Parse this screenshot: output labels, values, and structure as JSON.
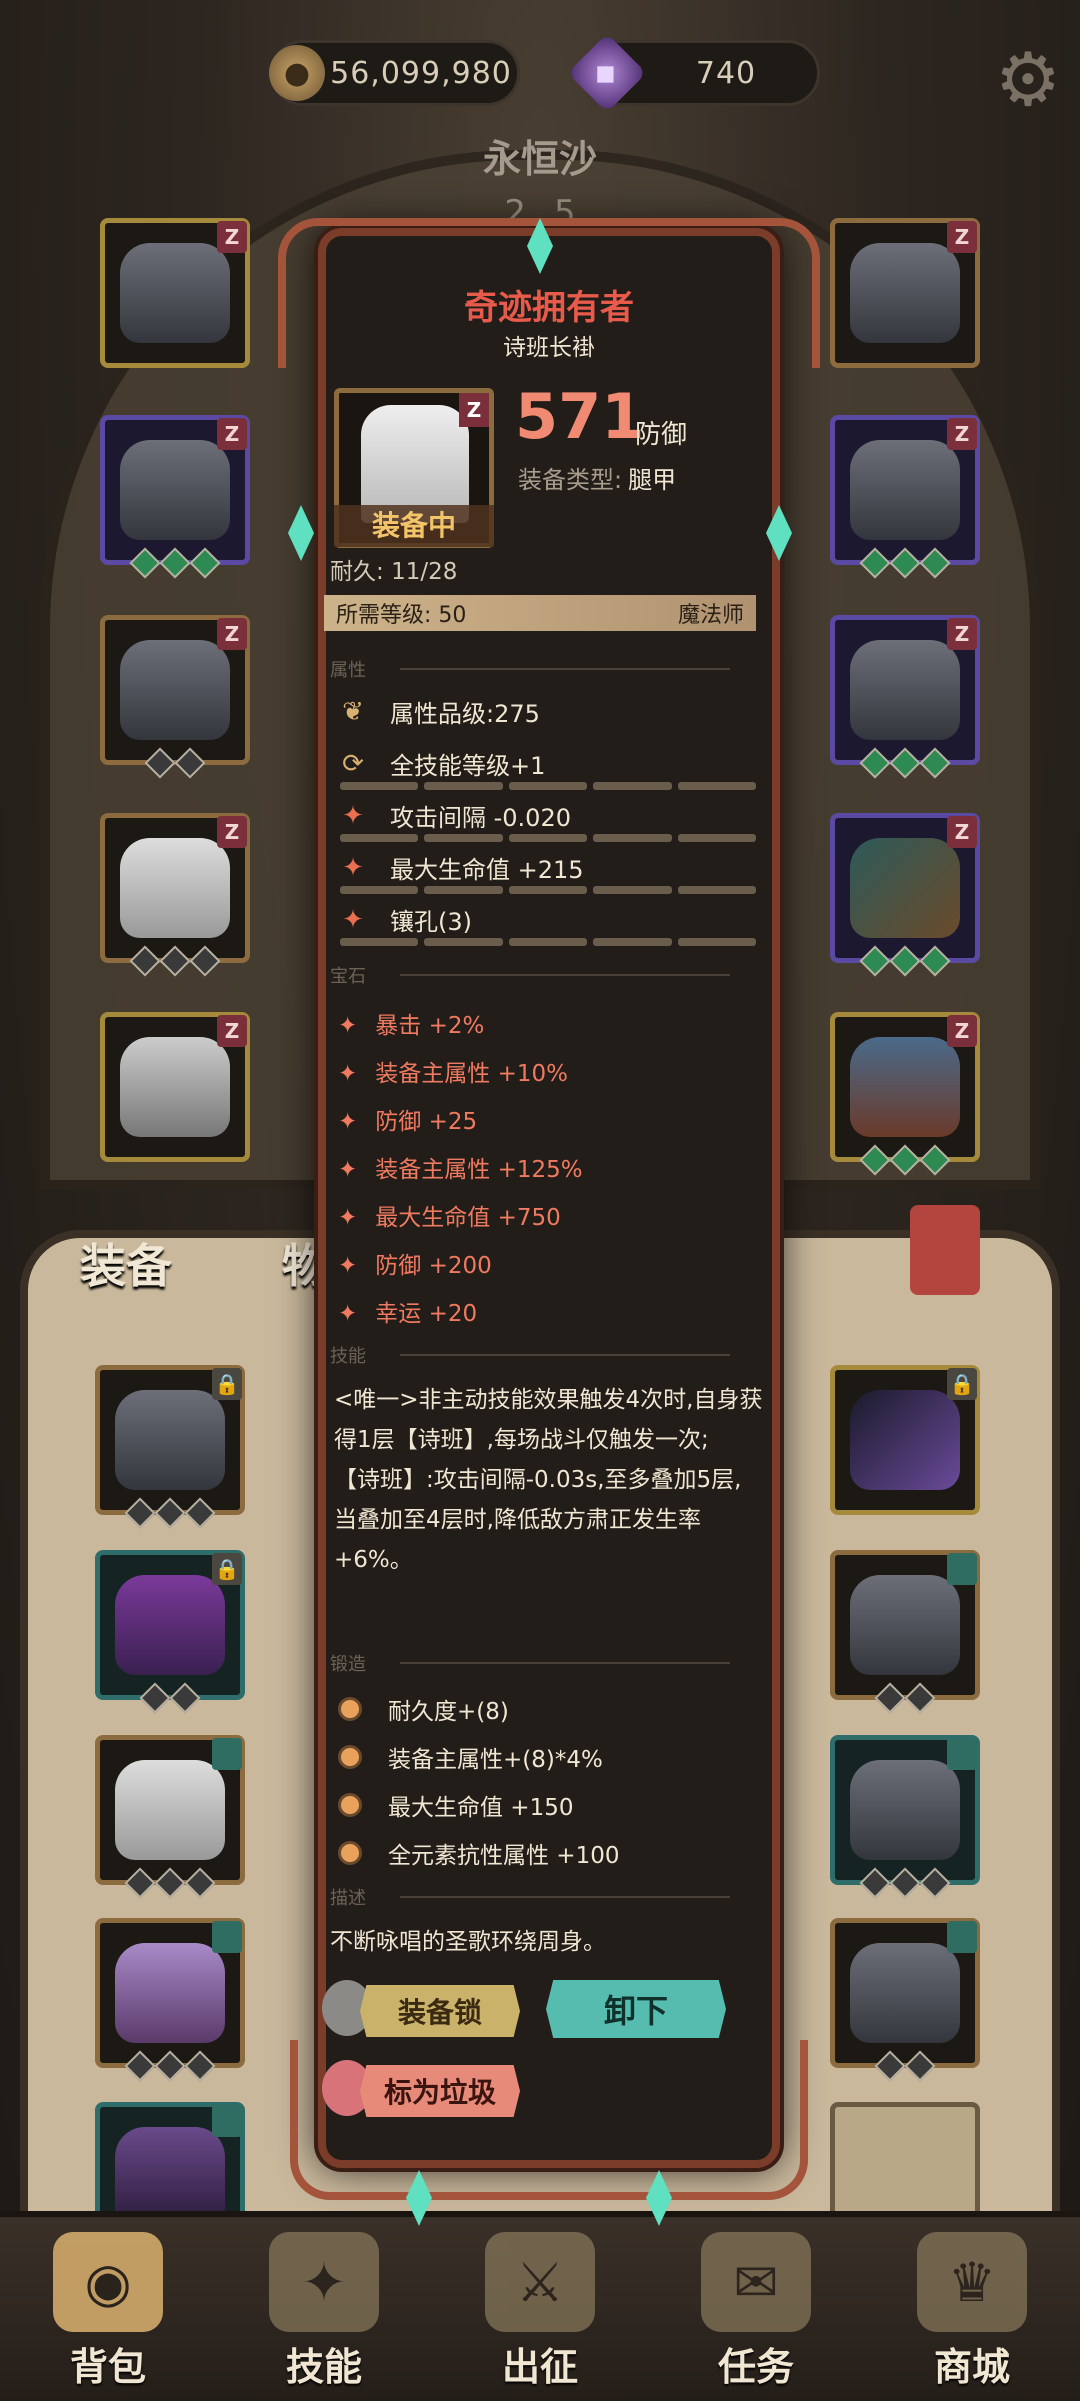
{
  "currency": {
    "coins": "56,099,980",
    "gems": "740"
  },
  "stage": {
    "name": "永恒沙",
    "num_a": "2",
    "num_b": "5"
  },
  "inventory_tabs": {
    "equipment": "装备",
    "items": "物品"
  },
  "slot_badge": "Z",
  "item": {
    "title": "奇迹拥有者",
    "name": "诗班长褂",
    "badge": "Z",
    "equipped_tag": "装备中",
    "durability_label": "耐久:",
    "durability_value": "11/28",
    "power": "571",
    "power_unit": "防御",
    "type_label": "装备类型:",
    "type_value": "腿甲",
    "req_label": "所需等级:",
    "req_level": "50",
    "req_class": "魔法师"
  },
  "sections": {
    "attributes": "属性",
    "gems": "宝石",
    "skills": "技能",
    "forge": "锻造",
    "desc": "描述"
  },
  "attributes": [
    "属性品级:275",
    "全技能等级+1",
    "攻击间隔 -0.020",
    "最大生命值 +215",
    "镶孔(3)"
  ],
  "gem_stats": [
    "暴击 +2%",
    "装备主属性 +10%",
    "防御 +25",
    "装备主属性 +125%",
    "最大生命值 +750",
    "防御 +200",
    "幸运 +20"
  ],
  "skill_text": {
    "line1": "<唯一>非主动技能效果触发4次时,自身获得1层【诗班】,每场战斗仅触发一次;",
    "line2": "【诗班】:攻击间隔-0.03s,至多叠加5层,当叠加至4层时,降低敌方肃正发生率+6%。"
  },
  "forge_stats": [
    "耐久度+(8)",
    "装备主属性+(8)*4%",
    "最大生命值 +150",
    "全元素抗性属性 +100"
  ],
  "description": "不断咏唱的圣歌环绕周身。",
  "buttons": {
    "lock": "装备锁",
    "unequip": "卸下",
    "junk": "标为垃圾"
  },
  "nav": {
    "bag": "背包",
    "skills": "技能",
    "battle": "出征",
    "quests": "任务",
    "shop": "商城"
  }
}
